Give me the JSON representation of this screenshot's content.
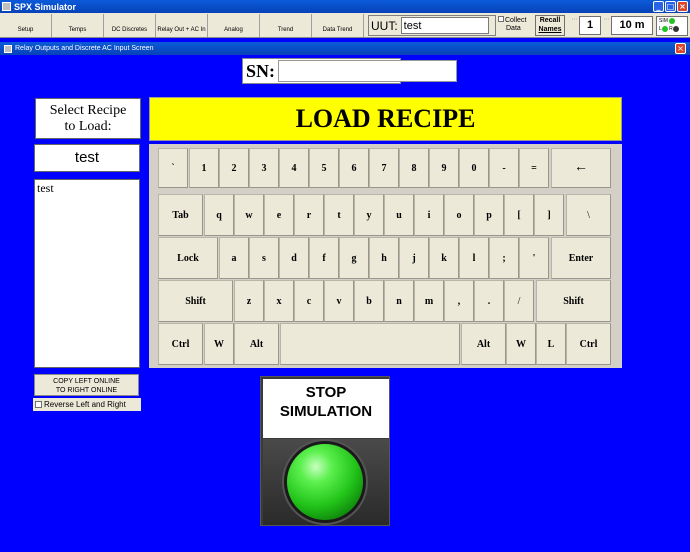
{
  "window": {
    "title": "SPX Simulator"
  },
  "nav_tabs": [
    "Setup",
    "Temps",
    "DC Discretes",
    "Relay Out + AC In",
    "Analog",
    "Trend",
    "Data Trend"
  ],
  "uut": {
    "label": "UUT:",
    "value": "test"
  },
  "collect_data": {
    "label_line1": "Collect",
    "label_line2": "Data"
  },
  "recall_names": {
    "line1": "Recall",
    "line2": "Names"
  },
  "counter": {
    "value": "1"
  },
  "interval": {
    "value": "10 m"
  },
  "sim": {
    "label": "SIM",
    "l": "L",
    "r": "R"
  },
  "child_window": {
    "title": "Relay Outputs and Discrete AC Input Screen"
  },
  "sn": {
    "label": "SN:",
    "value": ""
  },
  "select_recipe": {
    "line1": "Select Recipe",
    "line2": "to Load:"
  },
  "recipe_field": {
    "value": "test"
  },
  "recipe_list": {
    "items": [
      "test"
    ]
  },
  "copy_button": {
    "line1": "COPY LEFT ONLINE",
    "line2": "TO RIGHT ONLINE"
  },
  "reverse": {
    "label": "Reverse Left and Right"
  },
  "load_recipe": {
    "label": "LOAD RECIPE"
  },
  "keyboard": {
    "rows": [
      [
        "`",
        "1",
        "2",
        "3",
        "4",
        "5",
        "6",
        "7",
        "8",
        "9",
        "0",
        "-",
        "=",
        "←"
      ],
      [
        "Tab",
        "q",
        "w",
        "e",
        "r",
        "t",
        "y",
        "u",
        "i",
        "o",
        "p",
        "[",
        "]",
        "\\"
      ],
      [
        "Lock",
        "a",
        "s",
        "d",
        "f",
        "g",
        "h",
        "j",
        "k",
        "l",
        ";",
        "'",
        "Enter"
      ],
      [
        "Shift",
        "z",
        "x",
        "c",
        "v",
        "b",
        "n",
        "m",
        ",",
        ".",
        "/",
        "Shift"
      ],
      [
        "Ctrl",
        "W",
        "Alt",
        "",
        "Alt",
        "W",
        "L",
        "Ctrl"
      ]
    ]
  },
  "stop": {
    "line1": "STOP",
    "line2": "SIMULATION"
  },
  "colors": {
    "background": "#0000ff",
    "load_recipe_bg": "#ffff00",
    "stop_button": "#22c41a"
  }
}
